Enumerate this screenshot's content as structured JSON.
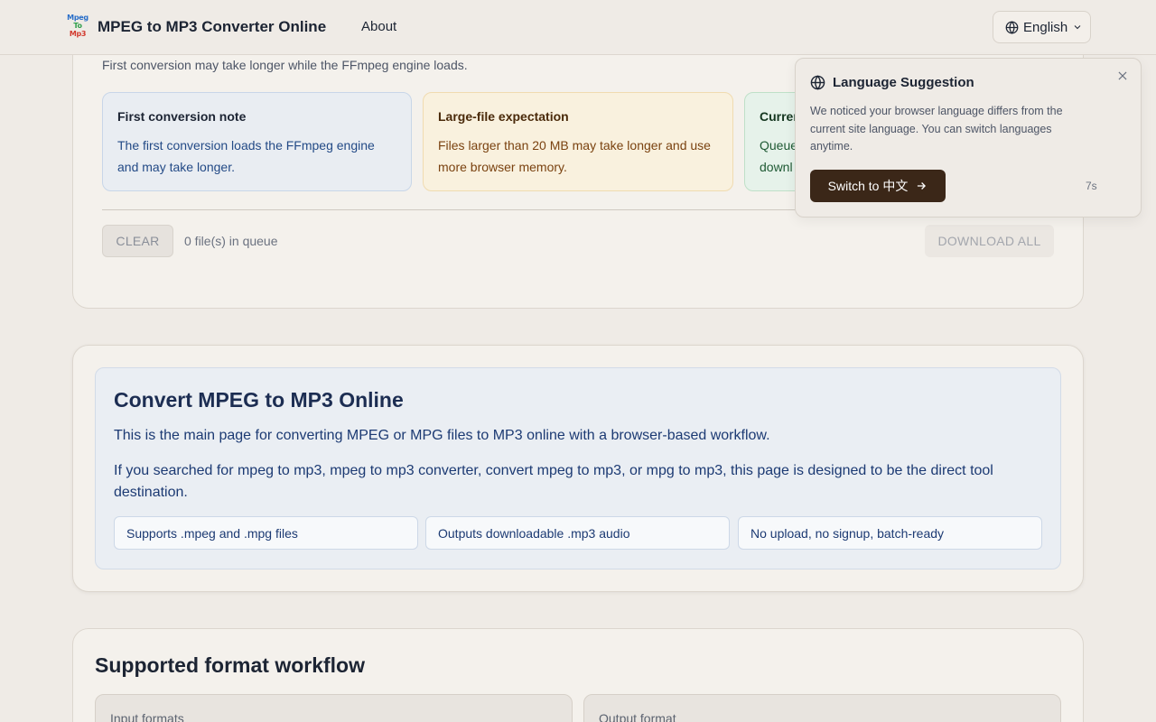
{
  "header": {
    "logo_lines": [
      "Mpeg",
      "To",
      "Mp3"
    ],
    "site_title": "MPEG to MP3 Converter Online",
    "nav_about": "About",
    "language_label": "English",
    "language_icon": "globe-icon",
    "dropdown_icon": "chevron-down-icon"
  },
  "converter": {
    "note_line": "First conversion may take longer while the FFmpeg engine loads.",
    "info_boxes": [
      {
        "title": "First conversion note",
        "body": "The first conversion loads the FFmpeg engine and may take longer."
      },
      {
        "title": "Large-file expectation",
        "body": "Files larger than 20 MB may take longer and use more browser memory."
      },
      {
        "title": "Curren",
        "body_line1": "Queue",
        "body_line2": "downl"
      }
    ],
    "clear_label": "CLEAR",
    "queue_text": "0 file(s) in queue",
    "download_all_label": "DOWNLOAD ALL"
  },
  "popup": {
    "title": "Language Suggestion",
    "body": "We noticed your browser language differs from the current site language. You can switch languages anytime.",
    "switch_label": "Switch to 中文",
    "countdown": "7s",
    "close_icon": "close-icon",
    "arrow_icon": "arrow-right-icon"
  },
  "intro": {
    "heading": "Convert MPEG to MP3 Online",
    "para1": "This is the main page for converting MPEG or MPG files to MP3 online with a browser-based workflow.",
    "para2": "If you searched for mpeg to mp3, mpeg to mp3 converter, convert mpeg to mp3, or mpg to mp3, this page is designed to be the direct tool destination.",
    "pills": [
      "Supports .mpeg and .mpg files",
      "Outputs downloadable .mp3 audio",
      "No upload, no signup, batch-ready"
    ]
  },
  "workflow": {
    "heading": "Supported format workflow",
    "input_label": "Input formats",
    "output_label": "Output format"
  },
  "colors": {
    "background": "#efebe6",
    "switch_button": "#3b2718",
    "info_blue": "#e9edf2",
    "info_yellow": "#f9f1de",
    "info_green": "#e6f2ea"
  }
}
